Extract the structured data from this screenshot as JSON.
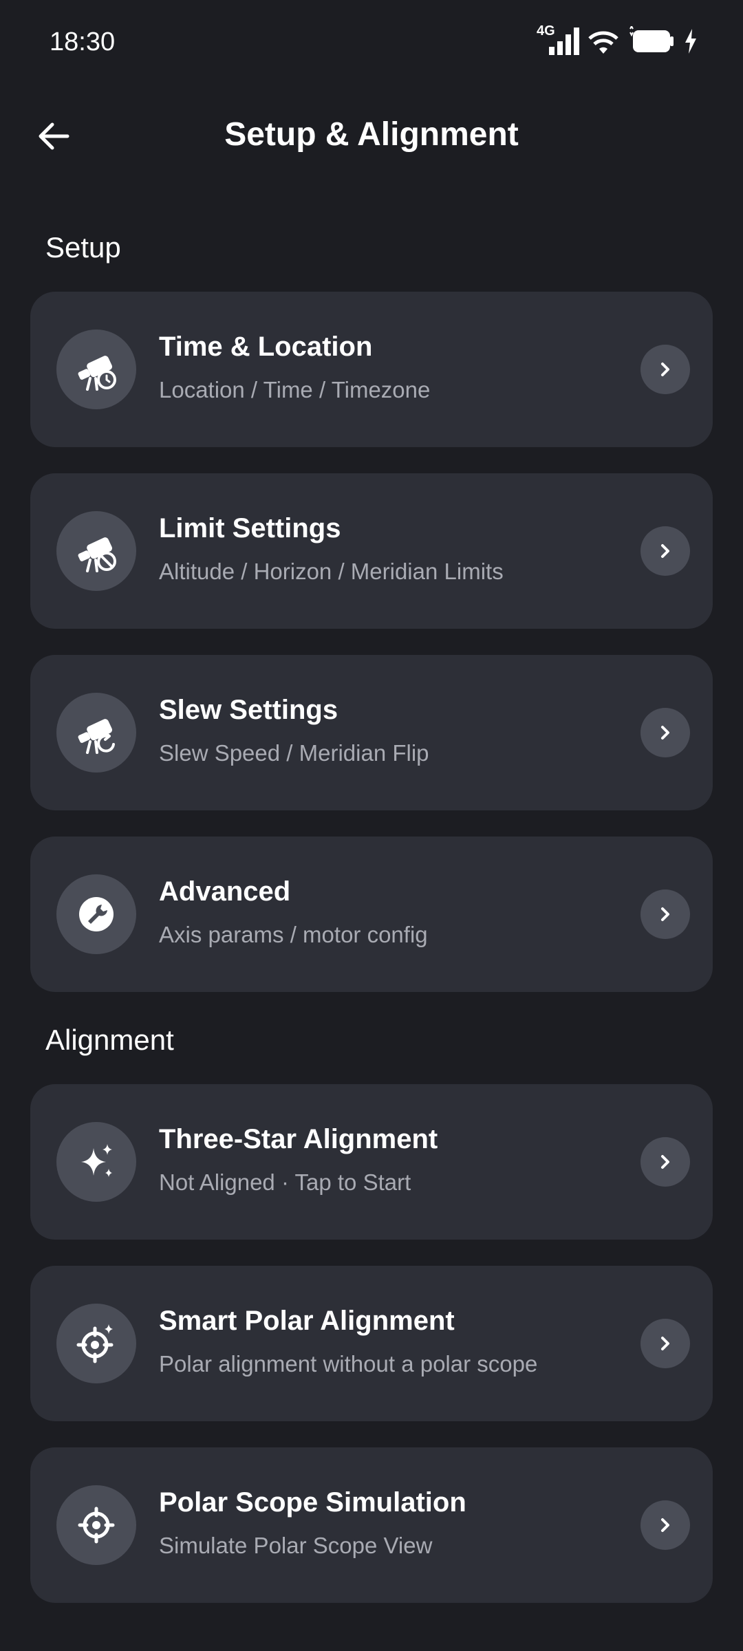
{
  "status": {
    "time": "18:30",
    "network": "4G"
  },
  "header": {
    "title": "Setup & Alignment"
  },
  "sections": {
    "setup": {
      "title": "Setup",
      "items": [
        {
          "title": "Time & Location",
          "subtitle": "Location / Time / Timezone",
          "icon": "telescope-clock-icon"
        },
        {
          "title": "Limit Settings",
          "subtitle": "Altitude / Horizon / Meridian Limits",
          "icon": "telescope-block-icon"
        },
        {
          "title": "Slew Settings",
          "subtitle": "Slew Speed / Meridian Flip",
          "icon": "telescope-rotate-icon"
        },
        {
          "title": "Advanced",
          "subtitle": "Axis params / motor config",
          "icon": "wrench-icon"
        }
      ]
    },
    "alignment": {
      "title": "Alignment",
      "items": [
        {
          "title": "Three-Star Alignment",
          "subtitle": "Not Aligned · Tap to Start",
          "icon": "sparkle-stars-icon"
        },
        {
          "title": "Smart Polar Alignment",
          "subtitle": "Polar alignment without a polar scope",
          "icon": "crosshair-sparkle-icon"
        },
        {
          "title": "Polar Scope Simulation",
          "subtitle": "Simulate Polar Scope View",
          "icon": "crosshair-icon"
        }
      ]
    }
  },
  "colors": {
    "background": "#1c1d22",
    "card": "#2d2f37",
    "icon_circle": "#4a4d57",
    "subtitle": "#a9abb3"
  }
}
